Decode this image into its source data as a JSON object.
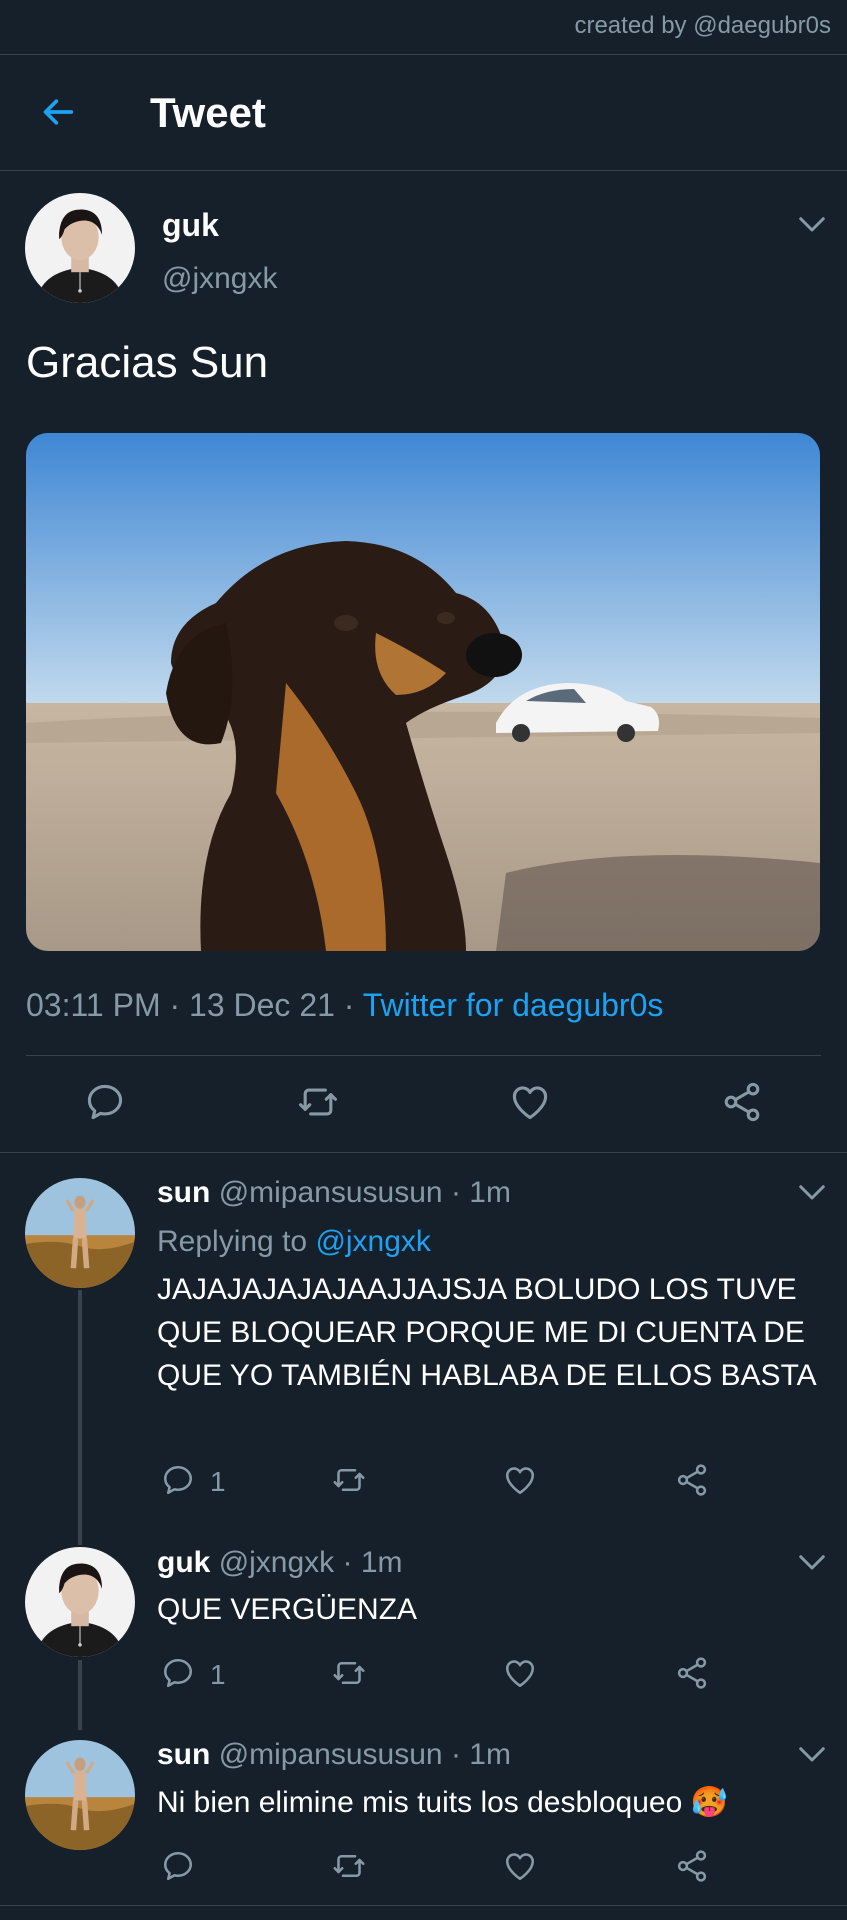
{
  "watermark": "created by @daegubr0s",
  "topbar": {
    "title": "Tweet"
  },
  "tweet": {
    "name": "guk",
    "handle": "@jxngxk",
    "text": "Gracias Sun",
    "time": "03:11 PM",
    "date": "13 Dec 21",
    "source": "Twitter for daegubr0s"
  },
  "replies": [
    {
      "name": "sun",
      "handle": "@mipansususun",
      "time": "1m",
      "replying_label": "Replying to",
      "replying_to": "@jxngxk",
      "text": "JAJAJAJAJAJAAJJAJSJA BOLUDO LOS TUVE QUE BLOQUEAR PORQUE ME DI CUENTA DE QUE YO TAMBIÉN HABLABA DE ELLOS BASTA",
      "reply_count": "1"
    },
    {
      "name": "guk",
      "handle": "@jxngxk",
      "time": "1m",
      "text": "QUE VERGÜENZA",
      "reply_count": "1"
    },
    {
      "name": "sun",
      "handle": "@mipansususun",
      "time": "1m",
      "text": "Ni bien elimine mis tuits los desbloqueo 🥵",
      "reply_count": ""
    }
  ],
  "icons": {
    "back": "arrow-left-icon",
    "chevron": "chevron-down-icon",
    "reply": "reply-icon",
    "retweet": "retweet-icon",
    "like": "heart-icon",
    "share": "share-icon"
  },
  "colors": {
    "background": "#15202b",
    "accent": "#1da1f2",
    "muted": "#8899a6",
    "divider": "#38444d"
  }
}
